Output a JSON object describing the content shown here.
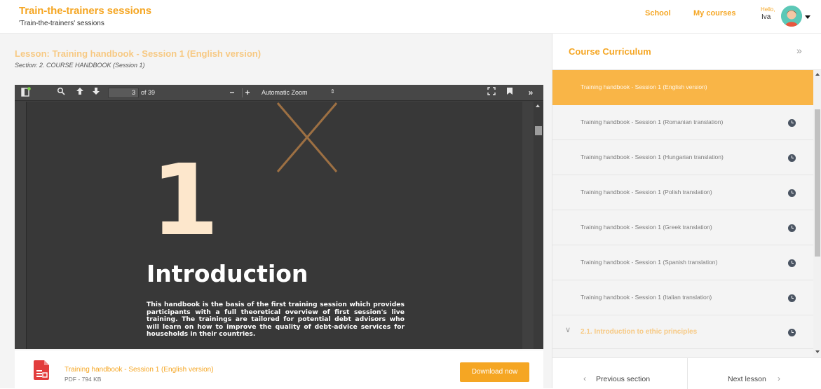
{
  "header": {
    "title": "Train-the-trainers sessions",
    "subtitle": "'Train-the-trainers' sessions",
    "nav": {
      "school": "School",
      "my_courses": "My courses"
    },
    "user": {
      "greeting": "Hello,",
      "name": "Iva"
    }
  },
  "lesson": {
    "title": "Lesson: Training handbook - Session 1 (English version)",
    "section": "Section: 2. COURSE HANDBOOK (Session 1)"
  },
  "viewer": {
    "current_page": "3",
    "page_count": "of 39",
    "zoom": "Automatic Zoom",
    "page_number_big": "1",
    "page_heading": "Introduction",
    "page_body": "This handbook is the basis of the first training session which provides participants with a full theoretical overview of first session's live training. The trainings are tailored for potential debt advisors who will learn on how to improve the quality of debt-advice services for households in their countries."
  },
  "download": {
    "file_name": "Training handbook - Session 1 (English version)",
    "file_meta": "PDF - 794 KB",
    "button_label": "Download now"
  },
  "sidebar": {
    "title": "Course Curriculum",
    "collapse_icon": "double-chevron-right-icon",
    "items": [
      {
        "label": "Training handbook - Session 1 (English version)",
        "active": true
      },
      {
        "label": "Training handbook - Session 1 (Romanian translation)",
        "active": false
      },
      {
        "label": "Training handbook - Session 1 (Hungarian translation)",
        "active": false
      },
      {
        "label": "Training handbook - Session 1 (Polish translation)",
        "active": false
      },
      {
        "label": "Training handbook - Session 1 (Greek translation)",
        "active": false
      },
      {
        "label": "Training handbook - Session 1 (Spanish translation)",
        "active": false
      },
      {
        "label": "Training handbook - Session 1 (Italian translation)",
        "active": false
      }
    ],
    "next_section": "2.1. Introduction to ethic principles",
    "footer": {
      "previous": "Previous section",
      "next": "Next lesson"
    }
  },
  "colors": {
    "accent": "#f5a623",
    "active_item": "#f9b547",
    "viewer_dark": "#383838",
    "clock_icon": "#4a5462"
  }
}
